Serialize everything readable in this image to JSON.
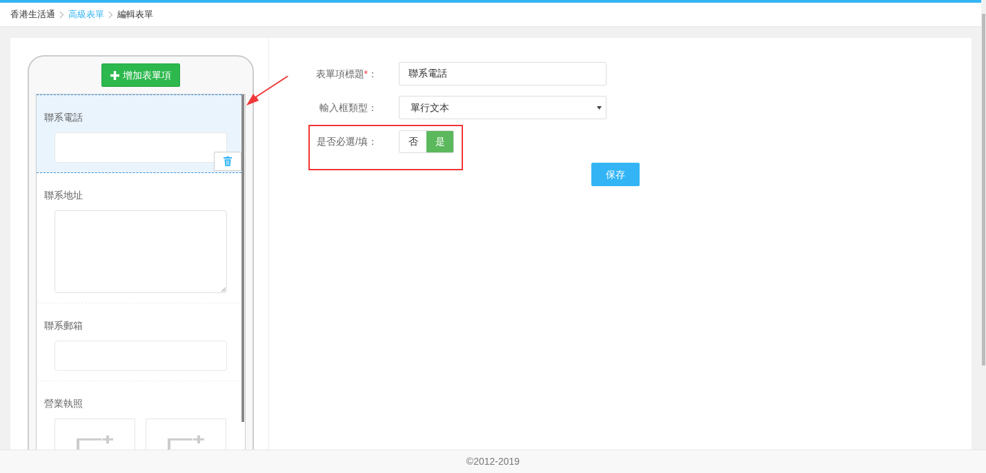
{
  "breadcrumb": [
    {
      "label": "香港生活通",
      "kind": "home"
    },
    {
      "label": "高級表單",
      "kind": "link"
    },
    {
      "label": "編輯表單",
      "kind": "current"
    }
  ],
  "preview": {
    "add_button": "增加表單項",
    "items": [
      {
        "label": "聯系電話",
        "kind": "input",
        "selected": true
      },
      {
        "label": "聯系地址",
        "kind": "textarea",
        "selected": false
      },
      {
        "label": "聯系郵箱",
        "kind": "input",
        "selected": false
      },
      {
        "label": "營業執照",
        "kind": "image_upload",
        "selected": false
      }
    ]
  },
  "form": {
    "fields": [
      {
        "kind": "text",
        "label": "表單項標題",
        "required_mark": "*",
        "label_end": "：",
        "value": "聯系電話"
      },
      {
        "kind": "select",
        "label": "輸入框類型",
        "label_end": "：",
        "value": "單行文本"
      },
      {
        "kind": "toggle",
        "label": "是否必選/填",
        "label_end": "：",
        "options": [
          {
            "label": "否",
            "selected": false
          },
          {
            "label": "是",
            "selected": true
          }
        ]
      }
    ],
    "save_button": "保存"
  },
  "footer": "©2012-2019"
}
